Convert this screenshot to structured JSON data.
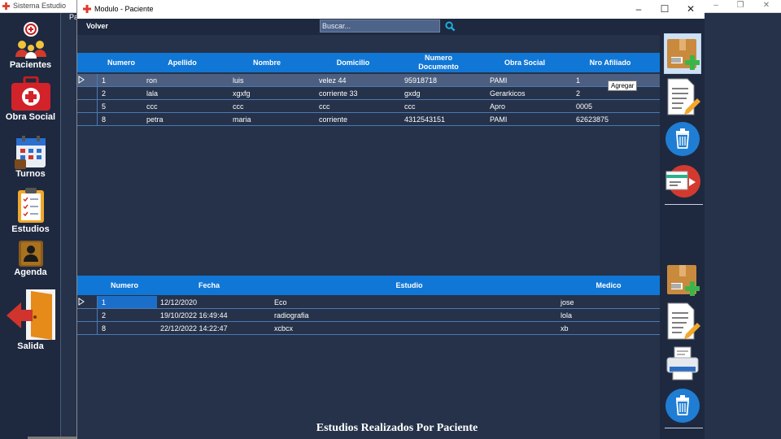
{
  "main_window": {
    "title": "Sistema Estudio",
    "top_label": "Pa",
    "sidebar": [
      {
        "label": "Pacientes",
        "icon": "patients-icon"
      },
      {
        "label": "Obra Social",
        "icon": "first-aid-kit-icon"
      },
      {
        "label": "Turnos",
        "icon": "calendar-icon"
      },
      {
        "label": "Estudios",
        "icon": "clipboard-icon"
      },
      {
        "label": "Agenda",
        "icon": "agenda-icon"
      },
      {
        "label": "Salida",
        "icon": "exit-door-icon"
      }
    ]
  },
  "dialog": {
    "title": "Modulo - Paciente",
    "back_label": "Volver",
    "search": {
      "value": "Buscar...",
      "placeholder": "Buscar..."
    },
    "patients_grid": {
      "columns": [
        "Numero",
        "Apellido",
        "Nombre",
        "Domicilio",
        "Numero Documento",
        "Obra Social",
        "Nro Afiliado"
      ],
      "rows": [
        [
          "1",
          "ron",
          "luis",
          "velez 44",
          "95918718",
          "PAMI",
          "1"
        ],
        [
          "2",
          "lala",
          "xgxfg",
          "corriente 33",
          "gxdg",
          "Gerarkicos",
          "2"
        ],
        [
          "5",
          "ccc",
          "ccc",
          "ccc",
          "ccc",
          "Apro",
          "0005"
        ],
        [
          "8",
          "petra",
          "maria",
          "corriente",
          "4312543151",
          "PAMI",
          "62623875"
        ]
      ],
      "selected_row": 0
    },
    "studies_grid": {
      "columns": [
        "Numero",
        "Fecha",
        "Estudio",
        "Medico"
      ],
      "rows": [
        [
          "1",
          "12/12/2020",
          "Eco",
          "jose"
        ],
        [
          "2",
          "19/10/2022 16:49:44",
          "radiografia",
          "lola"
        ],
        [
          "8",
          "22/12/2022 14:22:47",
          "xcbcx",
          "xb"
        ]
      ],
      "selected_row": 0
    },
    "studies_caption": "Estudios Realizados Por Paciente",
    "tooltip": "Agregar",
    "actions": [
      {
        "name": "add-patient-button",
        "icon": "box-plus-icon"
      },
      {
        "name": "edit-patient-button",
        "icon": "document-pencil-icon"
      },
      {
        "name": "delete-patient-button",
        "icon": "trash-icon"
      },
      {
        "name": "export-patient-button",
        "icon": "card-arrow-icon"
      },
      {
        "name": "add-study-button",
        "icon": "box-plus-icon"
      },
      {
        "name": "edit-study-button",
        "icon": "document-pencil-icon"
      },
      {
        "name": "print-study-button",
        "icon": "printer-icon"
      },
      {
        "name": "delete-study-button",
        "icon": "trash-icon"
      }
    ]
  },
  "colors": {
    "header_blue": "#1177d6",
    "panel_dark": "#25324a",
    "sidebar_dark": "#1e2940"
  }
}
